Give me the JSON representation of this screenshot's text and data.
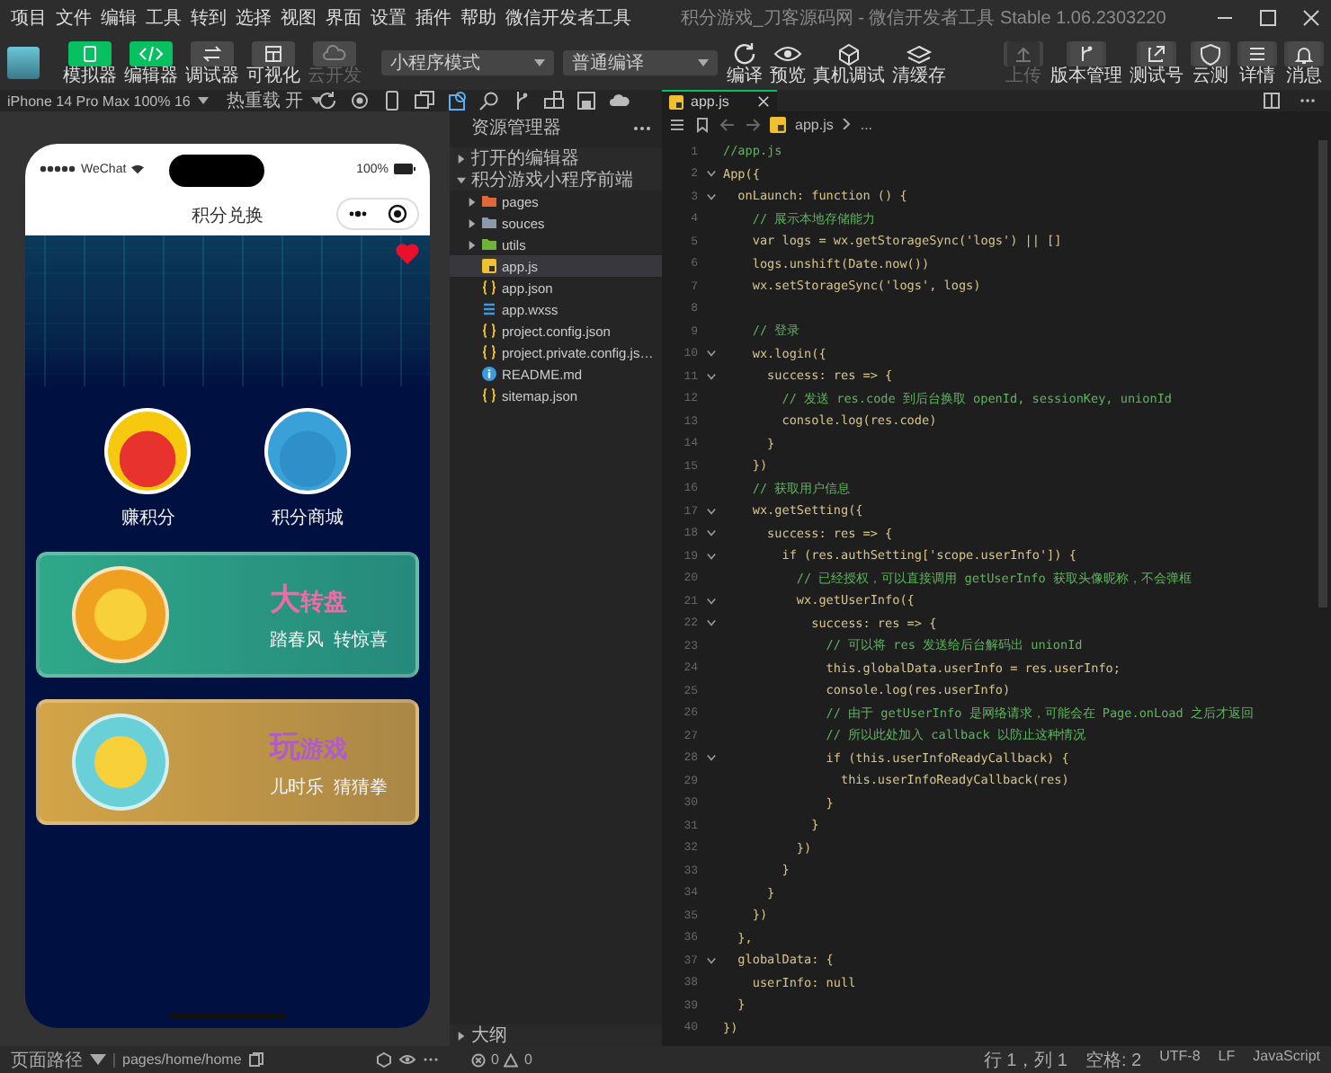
{
  "window": {
    "title": "积分游戏_刀客源码网 - 微信开发者工具 Stable 1.06.2303220"
  },
  "menu": [
    "项目",
    "文件",
    "编辑",
    "工具",
    "转到",
    "选择",
    "视图",
    "界面",
    "设置",
    "插件",
    "帮助",
    "微信开发者工具"
  ],
  "toolbar": {
    "view_buttons": [
      {
        "label": "模拟器",
        "on": true,
        "disabled": false
      },
      {
        "label": "编辑器",
        "on": true,
        "disabled": false
      },
      {
        "label": "调试器",
        "on": false,
        "disabled": false
      },
      {
        "label": "可视化",
        "on": false,
        "disabled": false
      },
      {
        "label": "云开发",
        "on": false,
        "disabled": true
      }
    ],
    "mode_select": "小程序模式",
    "compile_select": "普通编译",
    "actions": [
      {
        "label": "编译"
      },
      {
        "label": "预览"
      },
      {
        "label": "真机调试"
      },
      {
        "label": "清缓存"
      }
    ],
    "right_actions": [
      {
        "label": "上传",
        "disabled": true
      },
      {
        "label": "版本管理",
        "disabled": false
      },
      {
        "label": "测试号",
        "disabled": false
      },
      {
        "label": "云测",
        "disabled": false
      },
      {
        "label": "详情",
        "disabled": false
      },
      {
        "label": "消息",
        "disabled": false
      }
    ]
  },
  "device_bar": {
    "device": "iPhone 14 Pro Max 100% 16",
    "hot_reload": "热重载 开"
  },
  "editor_tabs": [
    {
      "label": "app.js",
      "selected": true
    }
  ],
  "simulator": {
    "carrier": "WeChat",
    "battery": "100%",
    "nav_title": "积分兑换",
    "entries": [
      {
        "label": "赚积分",
        "color": "#e8322d"
      },
      {
        "label": "积分商城",
        "color": "#2f8fc8"
      }
    ],
    "cards": [
      {
        "title": "大转盘",
        "subtitle": "踏春风  转惊喜",
        "color": "#2fa88a"
      },
      {
        "title": "玩游戏",
        "subtitle": "儿时乐  猜猜拳",
        "color": "#d4a548"
      }
    ]
  },
  "explorer": {
    "title": "资源管理器",
    "sections": [
      {
        "label": "打开的编辑器",
        "expanded": false
      },
      {
        "label": "积分游戏小程序前端",
        "expanded": true,
        "children": [
          {
            "name": "pages",
            "kind": "folder",
            "color": "#e0673a",
            "expanded": false,
            "selected": false
          },
          {
            "name": "souces",
            "kind": "folder",
            "color": "#8a9aa8",
            "expanded": false,
            "selected": false
          },
          {
            "name": "utils",
            "kind": "folder",
            "color": "#6fb33a",
            "expanded": false,
            "selected": false
          },
          {
            "name": "app.js",
            "kind": "js",
            "selected": true
          },
          {
            "name": "app.json",
            "kind": "json",
            "selected": false
          },
          {
            "name": "app.wxss",
            "kind": "wxss",
            "selected": false
          },
          {
            "name": "project.config.json",
            "kind": "json",
            "selected": false
          },
          {
            "name": "project.private.config.js…",
            "kind": "json",
            "selected": false
          },
          {
            "name": "README.md",
            "kind": "info",
            "selected": false
          },
          {
            "name": "sitemap.json",
            "kind": "json",
            "selected": false
          }
        ]
      }
    ],
    "outline": {
      "label": "大纲",
      "expanded": false
    },
    "problems": {
      "errors": "0",
      "warnings": "0"
    }
  },
  "editor": {
    "breadcrumb": [
      "app.js",
      "..."
    ],
    "lines": [
      {
        "n": "1",
        "text": "//app.js",
        "kind": "comment",
        "fold": false
      },
      {
        "n": "2",
        "text": "App({",
        "kind": "code",
        "fold": true
      },
      {
        "n": "3",
        "text": "  onLaunch: function () {",
        "kind": "code",
        "fold": true
      },
      {
        "n": "4",
        "text": "    // 展示本地存储能力",
        "kind": "comment",
        "fold": false
      },
      {
        "n": "5",
        "text": "    var logs = wx.getStorageSync('logs') || []",
        "kind": "code",
        "fold": false
      },
      {
        "n": "6",
        "text": "    logs.unshift(Date.now())",
        "kind": "code",
        "fold": false
      },
      {
        "n": "7",
        "text": "    wx.setStorageSync('logs', logs)",
        "kind": "code",
        "fold": false
      },
      {
        "n": "8",
        "fold": false
      },
      {
        "n": "9",
        "text": "    // 登录",
        "kind": "comment",
        "fold": false
      },
      {
        "n": "10",
        "text": "    wx.login({",
        "kind": "code",
        "fold": true
      },
      {
        "n": "11",
        "text": "      success: res => {",
        "kind": "code",
        "fold": true
      },
      {
        "n": "12",
        "text": "        // 发送 res.code 到后台换取 openId, sessionKey, unionId",
        "kind": "comment",
        "fold": false
      },
      {
        "n": "13",
        "text": "        console.log(res.code)",
        "kind": "code",
        "fold": false
      },
      {
        "n": "14",
        "text": "      }",
        "kind": "code",
        "fold": false
      },
      {
        "n": "15",
        "text": "    })",
        "kind": "code",
        "fold": false
      },
      {
        "n": "16",
        "text": "    // 获取用户信息",
        "kind": "comment",
        "fold": false
      },
      {
        "n": "17",
        "text": "    wx.getSetting({",
        "kind": "code",
        "fold": true
      },
      {
        "n": "18",
        "text": "      success: res => {",
        "kind": "code",
        "fold": true
      },
      {
        "n": "19",
        "text": "        if (res.authSetting['scope.userInfo']) {",
        "kind": "code",
        "fold": true
      },
      {
        "n": "20",
        "text": "          // 已经授权，可以直接调用 getUserInfo 获取头像昵称，不会弹框",
        "kind": "comment",
        "fold": false
      },
      {
        "n": "21",
        "text": "          wx.getUserInfo({",
        "kind": "code",
        "fold": true
      },
      {
        "n": "22",
        "text": "            success: res => {",
        "kind": "code",
        "fold": true
      },
      {
        "n": "23",
        "text": "              // 可以将 res 发送给后台解码出 unionId",
        "kind": "comment",
        "fold": false
      },
      {
        "n": "24",
        "text": "              this.globalData.userInfo = res.userInfo;",
        "kind": "code",
        "fold": false
      },
      {
        "n": "25",
        "text": "              console.log(res.userInfo)",
        "kind": "code",
        "fold": false
      },
      {
        "n": "26",
        "text": "              // 由于 getUserInfo 是网络请求，可能会在 Page.onLoad 之后才返回",
        "kind": "comment",
        "fold": false
      },
      {
        "n": "27",
        "text": "              // 所以此处加入 callback 以防止这种情况",
        "kind": "comment",
        "fold": false
      },
      {
        "n": "28",
        "text": "              if (this.userInfoReadyCallback) {",
        "kind": "code",
        "fold": true
      },
      {
        "n": "29",
        "text": "                this.userInfoReadyCallback(res)",
        "kind": "code",
        "fold": false
      },
      {
        "n": "30",
        "text": "              }",
        "kind": "code",
        "fold": false
      },
      {
        "n": "31",
        "text": "            }",
        "kind": "code",
        "fold": false
      },
      {
        "n": "32",
        "text": "          })",
        "kind": "code",
        "fold": false
      },
      {
        "n": "33",
        "text": "        }",
        "kind": "code",
        "fold": false
      },
      {
        "n": "34",
        "text": "      }",
        "kind": "code",
        "fold": false
      },
      {
        "n": "35",
        "text": "    })",
        "kind": "code",
        "fold": false
      },
      {
        "n": "36",
        "text": "  },",
        "kind": "code",
        "fold": false
      },
      {
        "n": "37",
        "text": "  globalData: {",
        "kind": "code",
        "fold": true
      },
      {
        "n": "38",
        "text": "    userInfo: null",
        "kind": "code",
        "fold": false
      },
      {
        "n": "39",
        "text": "  }",
        "kind": "code",
        "fold": false
      },
      {
        "n": "40",
        "text": "})",
        "kind": "code",
        "fold": false
      }
    ]
  },
  "status_bar": {
    "page_path_label": "页面路径",
    "page_path": "pages/home/home",
    "editor_status": [
      "行 1，列 1",
      "空格: 2",
      "UTF-8",
      "LF",
      "JavaScript"
    ]
  }
}
